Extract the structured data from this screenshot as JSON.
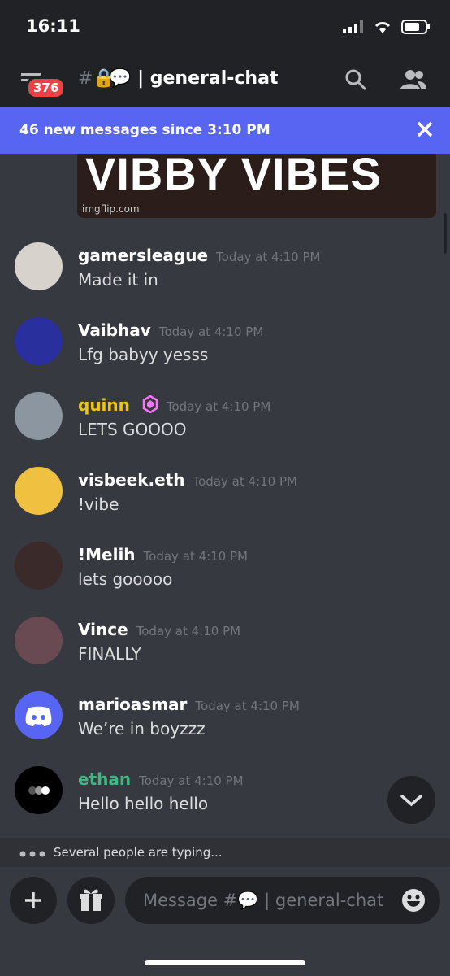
{
  "status": {
    "time": "16:11"
  },
  "header": {
    "badge": "376",
    "channel_prefix": "#🔒",
    "channel_emoji": "💬",
    "channel_name": " | general-chat"
  },
  "banner": {
    "text": "46 new messages since 3:10 PM"
  },
  "embed": {
    "title": "VIBBY VIBES",
    "source": "imgflip.com"
  },
  "messages": [
    {
      "author": "gamersleague",
      "time": "Today at 4:10 PM",
      "text": "Made it in",
      "color": "#ffffff",
      "avatar_bg": "#d7d2cc"
    },
    {
      "author": "Vaibhav",
      "time": "Today at 4:10 PM",
      "text": "Lfg babyy yesss",
      "color": "#ffffff",
      "avatar_bg": "#2a2f9e"
    },
    {
      "author": "quinn",
      "time": "Today at 4:10 PM",
      "text": "LETS GOOOO",
      "color": "#f1c40f",
      "avatar_bg": "#8c96a0"
    },
    {
      "author": "visbeek.eth",
      "time": "Today at 4:10 PM",
      "text": "!vibe",
      "color": "#ffffff",
      "avatar_bg": "#f0c040"
    },
    {
      "author": "!Melih",
      "time": "Today at 4:10 PM",
      "text": "lets gooooo",
      "color": "#ffffff",
      "avatar_bg": "#3a2a2a"
    },
    {
      "author": "Vince",
      "time": "Today at 4:10 PM",
      "text": "FINALLY",
      "color": "#ffffff",
      "avatar_bg": "#6a4a52"
    },
    {
      "author": "marioasmar",
      "time": "Today at 4:10 PM",
      "text": "We’re in boyzzz",
      "color": "#ffffff",
      "avatar_bg": "#5865f2"
    },
    {
      "author": "ethan",
      "time": "Today at 4:10 PM",
      "text": "Hello hello hello",
      "color": "#43b581",
      "avatar_bg": "#000000"
    }
  ],
  "typing": {
    "text": "Several people are typing..."
  },
  "composer": {
    "placeholder_prefix": "Message #",
    "placeholder_emoji": "💬",
    "placeholder_channel": " | general-chat"
  }
}
